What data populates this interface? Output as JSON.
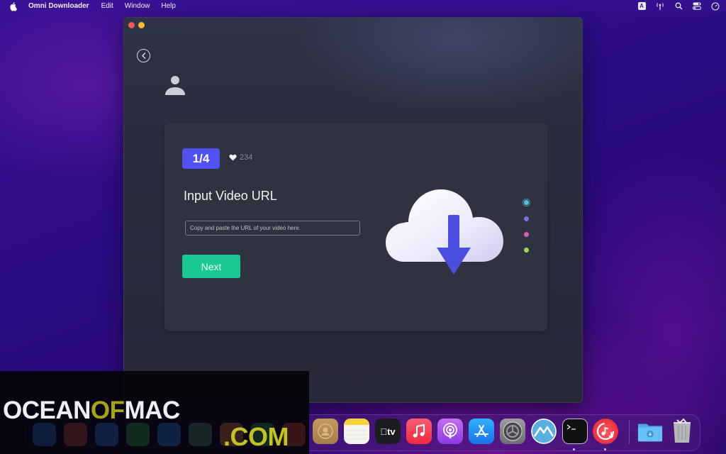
{
  "menubar": {
    "app_name": "Omni Downloader",
    "items": [
      "Edit",
      "Window",
      "Help"
    ],
    "status_icons": [
      "input-source-icon",
      "antenna-icon",
      "search-icon",
      "control-center-icon",
      "clock-icon"
    ],
    "input_source_label": "A"
  },
  "window": {
    "traffic_lights": [
      "close",
      "minimize"
    ],
    "back_icon": "chevron-left-icon",
    "user_icon": "user-icon",
    "card": {
      "step": "1/4",
      "likes": "234",
      "title": "Input Video URL",
      "url_input": {
        "value": "",
        "placeholder": "Copy and paste the URL of your video here."
      },
      "next_label": "Next",
      "illustration": "cloud-download-icon",
      "step_dots": [
        {
          "color": "#4fc3d8",
          "active": true
        },
        {
          "color": "#7c6fe0",
          "active": false
        },
        {
          "color": "#d65cb7",
          "active": false
        },
        {
          "color": "#a8d35a",
          "active": false
        }
      ]
    }
  },
  "colors": {
    "accent": "#5150f0",
    "next_button": "#19c892",
    "card_bg": "#2f3340",
    "window_bg": "#2b2d3e"
  },
  "dock": {
    "apps": [
      "Finder",
      "Launchpad",
      "Safari",
      "Messages",
      "Mail",
      "Maps",
      "Photos",
      "FaceTime",
      "Calendar",
      "Contacts",
      "Notes",
      "TV",
      "Music",
      "Podcasts",
      "App Store",
      "System Preferences",
      "Monterey",
      "Terminal",
      "Omni Downloader",
      "Downloads",
      "Trash"
    ],
    "tv_label": "tv"
  },
  "watermark": {
    "part1": "OCEAN",
    "part2": "OF",
    "part3": "MAC",
    "line2": ".COM"
  }
}
